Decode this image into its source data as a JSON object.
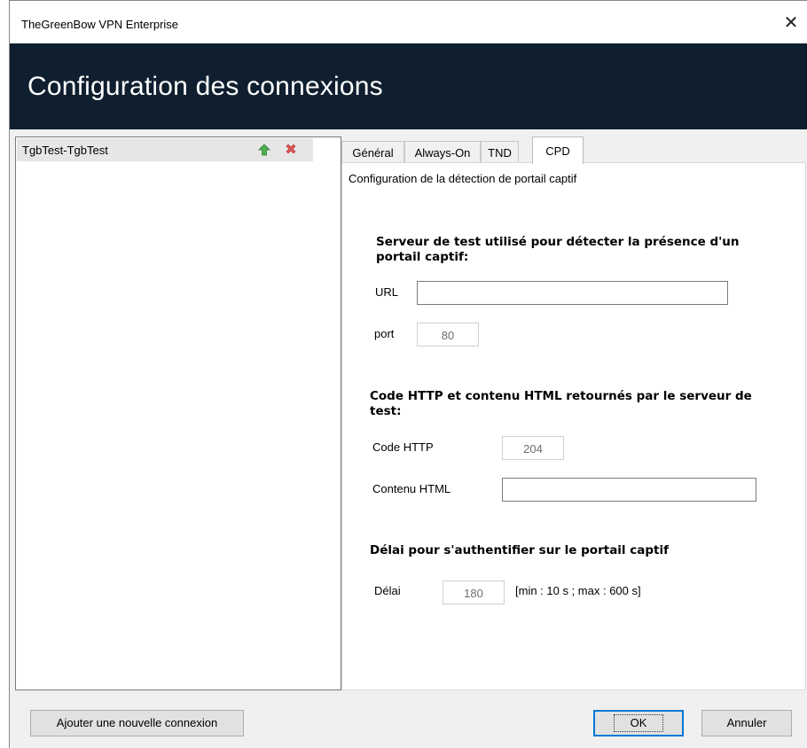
{
  "window": {
    "title": "TheGreenBow VPN Enterprise",
    "close_glyph": "✕"
  },
  "banner": {
    "title": "Configuration des connexions"
  },
  "connections": {
    "items": [
      {
        "label": "TgbTest-TgbTest"
      }
    ]
  },
  "tabs": [
    {
      "label": "Général"
    },
    {
      "label": "Always-On"
    },
    {
      "label": "TND"
    },
    {
      "label": "CPD",
      "active": true
    }
  ],
  "cpd": {
    "description": "Configuration de la détection de portail captif",
    "test_server": {
      "title": "Serveur de test utilisé pour détecter la présence d'un portail captif:",
      "url_label": "URL",
      "url_value": "",
      "port_label": "port",
      "port_value": "80"
    },
    "http_response": {
      "title": "Code HTTP et contenu HTML retournés par le serveur de test:",
      "code_label": "Code HTTP",
      "code_value": "204",
      "html_label": "Contenu HTML",
      "html_value": ""
    },
    "auth_delay": {
      "title": "Délai pour s'authentifier sur le portail captif",
      "delay_label": "Délai",
      "delay_value": "180",
      "range_hint": "[min : 10 s ; max : 600 s]"
    }
  },
  "footer": {
    "add_connection": "Ajouter une nouvelle connexion",
    "ok": "OK",
    "cancel": "Annuler"
  },
  "colors": {
    "banner_bg": "#0f1f2f",
    "up_arrow": "#4caf50",
    "delete": "#e05555",
    "ok_border": "#0078d7"
  }
}
